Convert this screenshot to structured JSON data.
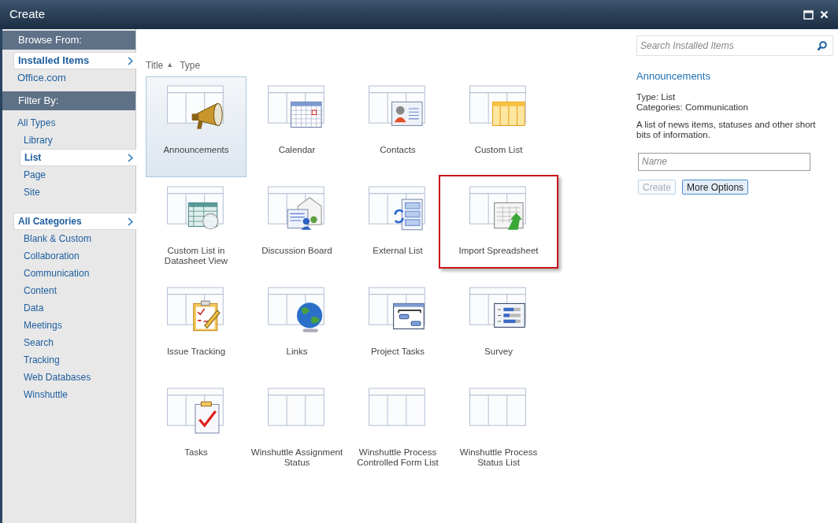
{
  "window": {
    "title": "Create"
  },
  "sidebar": {
    "browse_heading": "Browse From:",
    "browse_items": [
      {
        "label": "Installed Items",
        "selected": true
      },
      {
        "label": "Office.com",
        "selected": false
      }
    ],
    "filter_heading": "Filter By:",
    "types": {
      "label": "All Types",
      "selected": false,
      "children": [
        {
          "label": "Library",
          "selected": false
        },
        {
          "label": "List",
          "selected": true
        },
        {
          "label": "Page",
          "selected": false
        },
        {
          "label": "Site",
          "selected": false
        }
      ]
    },
    "categories": {
      "label": "All Categories",
      "selected": true,
      "children": [
        {
          "label": "Blank & Custom",
          "selected": false
        },
        {
          "label": "Collaboration",
          "selected": false
        },
        {
          "label": "Communication",
          "selected": false
        },
        {
          "label": "Content",
          "selected": false
        },
        {
          "label": "Data",
          "selected": false
        },
        {
          "label": "Meetings",
          "selected": false
        },
        {
          "label": "Search",
          "selected": false
        },
        {
          "label": "Tracking",
          "selected": false
        },
        {
          "label": "Web Databases",
          "selected": false
        },
        {
          "label": "Winshuttle",
          "selected": false
        }
      ]
    }
  },
  "sort": {
    "title": "Title",
    "sort_arrow": "▲",
    "type": "Type"
  },
  "items": [
    {
      "label": "Announcements",
      "kind": "megaphone",
      "selected": true,
      "highlighted": false
    },
    {
      "label": "Calendar",
      "kind": "calendar",
      "selected": false,
      "highlighted": false
    },
    {
      "label": "Contacts",
      "kind": "contact",
      "selected": false,
      "highlighted": false
    },
    {
      "label": "Custom List",
      "kind": "columns",
      "selected": false,
      "highlighted": false
    },
    {
      "label": "Custom List in Datasheet View",
      "kind": "datasheet",
      "selected": false,
      "highlighted": false
    },
    {
      "label": "Discussion Board",
      "kind": "discussion",
      "selected": false,
      "highlighted": false
    },
    {
      "label": "External List",
      "kind": "external",
      "selected": false,
      "highlighted": false
    },
    {
      "label": "Import Spreadsheet",
      "kind": "spreadsheet",
      "selected": false,
      "highlighted": true
    },
    {
      "label": "Issue Tracking",
      "kind": "clipboard",
      "selected": false,
      "highlighted": false
    },
    {
      "label": "Links",
      "kind": "globe",
      "selected": false,
      "highlighted": false
    },
    {
      "label": "Project Tasks",
      "kind": "gantt",
      "selected": false,
      "highlighted": false
    },
    {
      "label": "Survey",
      "kind": "survey",
      "selected": false,
      "highlighted": false
    },
    {
      "label": "Tasks",
      "kind": "check",
      "selected": false,
      "highlighted": false
    },
    {
      "label": "Winshuttle Assignment Status",
      "kind": "plain",
      "selected": false,
      "highlighted": false
    },
    {
      "label": "Winshuttle Process Controlled Form List",
      "kind": "plain",
      "selected": false,
      "highlighted": false
    },
    {
      "label": "Winshuttle Process Status List",
      "kind": "plain",
      "selected": false,
      "highlighted": false
    }
  ],
  "details": {
    "search_placeholder": "Search Installed Items",
    "title": "Announcements",
    "type": "Type: List",
    "categories": "Categories: Communication",
    "description": "A list of news items, statuses and other short bits of information.",
    "name_placeholder": "Name",
    "create_button": {
      "label": "Create",
      "disabled": true
    },
    "more_button": "More Options"
  }
}
